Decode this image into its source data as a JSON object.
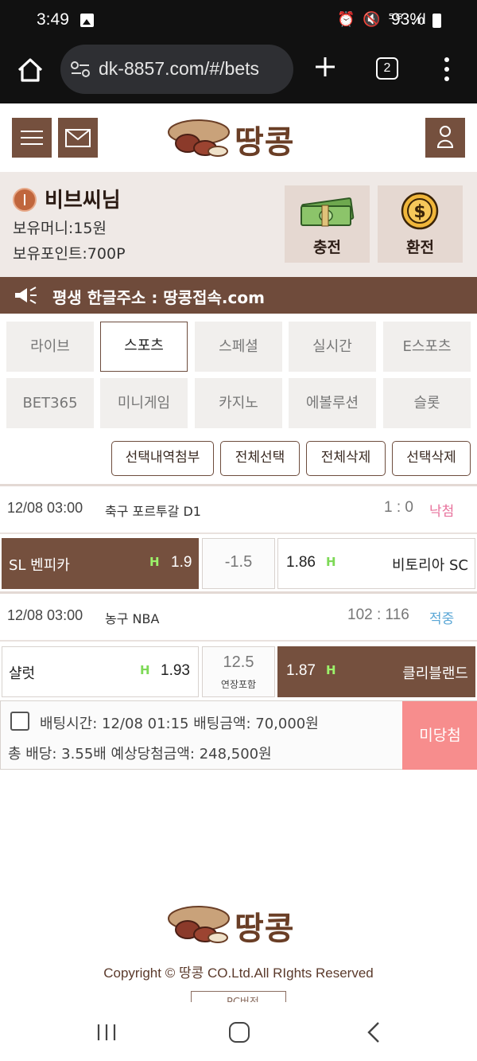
{
  "status_bar": {
    "time": "3:49",
    "icons": "⏰ 🔇 ⁵ᴳ .ıl",
    "battery": "93%"
  },
  "browser": {
    "url": "dk-8857.com/#/bets",
    "tab_count": "2"
  },
  "site": {
    "logo_text": "땅콩",
    "brand_color": "#75503e"
  },
  "user": {
    "name": "비브씨님",
    "money": "보유머니:15원",
    "points": "보유포인트:700P",
    "charge_label": "충전",
    "exchange_label": "환전"
  },
  "banner": {
    "text": "평생 한글주소 : 땅콩접속.com"
  },
  "categories": [
    {
      "label": "라이브"
    },
    {
      "label": "스포츠",
      "active": true
    },
    {
      "label": "스페셜"
    },
    {
      "label": "실시간"
    },
    {
      "label": "E스포츠"
    },
    {
      "label": "BET365"
    },
    {
      "label": "미니게임"
    },
    {
      "label": "카지노"
    },
    {
      "label": "에볼루션"
    },
    {
      "label": "슬롯"
    }
  ],
  "selection_buttons": [
    {
      "label": "선택내역첨부"
    },
    {
      "label": "전체선택"
    },
    {
      "label": "전체삭제"
    },
    {
      "label": "선택삭제"
    }
  ],
  "matches": [
    {
      "date": "12/08 03:00",
      "league": "축구 포르투갈 D1",
      "score": "1 : 0",
      "result": "낙첨",
      "result_color": "#e8729c",
      "home": {
        "team": "SL 벤피카",
        "odds": "1.9",
        "handicap_mark": "H",
        "selected": true
      },
      "line": "-1.5",
      "line_sub": "",
      "away": {
        "team": "비토리아 SC",
        "odds": "1.86",
        "handicap_mark": "H",
        "selected": false
      }
    },
    {
      "date": "12/08 03:00",
      "league": "농구 NBA",
      "score": "102 : 116",
      "result": "적중",
      "result_color": "#5aa7d6",
      "home": {
        "team": "샬럿",
        "odds": "1.93",
        "handicap_mark": "H",
        "selected": false
      },
      "line": "12.5",
      "line_sub": "연장포함",
      "away": {
        "team": "클리블랜드",
        "odds": "1.87",
        "handicap_mark": "H",
        "selected": true
      }
    }
  ],
  "bet_slip": {
    "line1": "배팅시간: 12/08 01:15  배팅금액: 70,000원",
    "line2": "총 배당: 3.55배  예상당첨금액: 248,500원",
    "status": "미당첨",
    "status_color": "#f78d8d"
  },
  "footer": {
    "copyright": "Copyright © 땅콩 CO.Ltd.All RIghts Reserved",
    "pc_button": "PC버전"
  }
}
